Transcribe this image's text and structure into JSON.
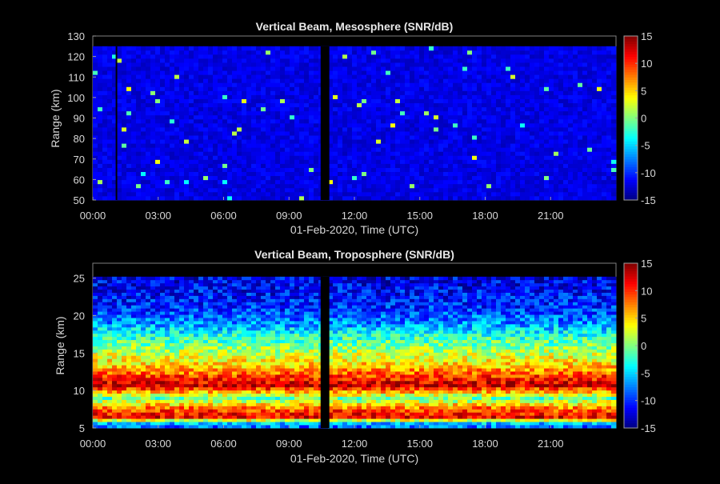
{
  "chart_data": [
    {
      "type": "heatmap",
      "title": "Vertical Beam, Mesosphere (SNR/dB)",
      "xlabel": "01-Feb-2020, Time (UTC)",
      "ylabel": "Range (km)",
      "xlim_hours": [
        0,
        24
      ],
      "ylim": [
        50,
        130
      ],
      "data_range_km": [
        50,
        125
      ],
      "x_ticks": [
        "00:00",
        "03:00",
        "06:00",
        "09:00",
        "12:00",
        "15:00",
        "18:00",
        "21:00"
      ],
      "y_ticks": [
        50,
        60,
        70,
        80,
        90,
        100,
        110,
        120,
        130
      ],
      "colorbar": {
        "min": -15,
        "max": 15,
        "ticks": [
          15,
          10,
          5,
          0,
          -5,
          -10,
          -15
        ],
        "colormap": "jet"
      },
      "gaps_hours": [
        [
          1.05,
          1.12
        ],
        [
          10.45,
          10.85
        ]
      ],
      "field_description_level": "mostly around -12 dB with sparse isolated higher points"
    },
    {
      "type": "heatmap",
      "title": "Vertical Beam, Troposphere (SNR/dB)",
      "xlabel": "01-Feb-2020, Time (UTC)",
      "ylabel": "Range (km)",
      "xlim_hours": [
        0,
        24
      ],
      "ylim": [
        5,
        27
      ],
      "data_range_km": [
        5,
        25.2
      ],
      "x_ticks": [
        "00:00",
        "03:00",
        "06:00",
        "09:00",
        "12:00",
        "15:00",
        "18:00",
        "21:00"
      ],
      "y_ticks": [
        5,
        10,
        15,
        20,
        25
      ],
      "colorbar": {
        "min": -15,
        "max": 15,
        "ticks": [
          15,
          10,
          5,
          0,
          -5,
          -10,
          -15
        ],
        "colormap": "jet"
      },
      "gaps_hours": [
        [
          10.45,
          10.85
        ]
      ],
      "snr_profile_by_range_km": [
        {
          "range": 5.5,
          "snr": -8
        },
        {
          "range": 6.5,
          "snr": 12
        },
        {
          "range": 7.5,
          "snr": 9
        },
        {
          "range": 8.3,
          "snr": 4
        },
        {
          "range": 9,
          "snr": -1
        },
        {
          "range": 9.8,
          "snr": 6
        },
        {
          "range": 10.7,
          "snr": 13
        },
        {
          "range": 11.8,
          "snr": 10
        },
        {
          "range": 13,
          "snr": 6
        },
        {
          "range": 14.5,
          "snr": 3
        },
        {
          "range": 16,
          "snr": 0
        },
        {
          "range": 17.5,
          "snr": -3
        },
        {
          "range": 19,
          "snr": -7
        },
        {
          "range": 21,
          "snr": -10
        },
        {
          "range": 23,
          "snr": -11
        },
        {
          "range": 25.2,
          "snr": -12
        }
      ]
    }
  ]
}
